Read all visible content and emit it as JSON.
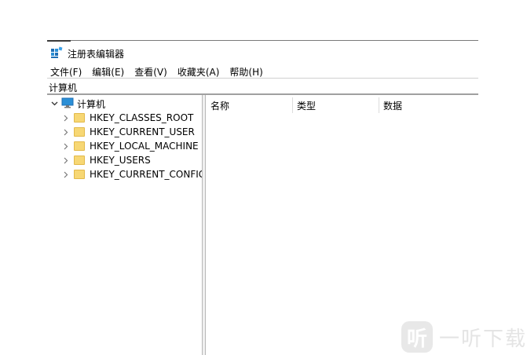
{
  "window": {
    "title": "注册表编辑器",
    "app_icon": "regedit-icon"
  },
  "menu": [
    {
      "label": "文件(F)"
    },
    {
      "label": "编辑(E)"
    },
    {
      "label": "查看(V)"
    },
    {
      "label": "收藏夹(A)"
    },
    {
      "label": "帮助(H)"
    }
  ],
  "address": {
    "value": "计算机"
  },
  "tree": {
    "root": {
      "label": "计算机",
      "icon": "computer-icon",
      "expanded": true
    },
    "children": [
      {
        "label": "HKEY_CLASSES_ROOT",
        "icon": "folder-icon"
      },
      {
        "label": "HKEY_CURRENT_USER",
        "icon": "folder-icon"
      },
      {
        "label": "HKEY_LOCAL_MACHINE",
        "icon": "folder-icon"
      },
      {
        "label": "HKEY_USERS",
        "icon": "folder-icon"
      },
      {
        "label": "HKEY_CURRENT_CONFIG",
        "icon": "folder-icon"
      }
    ]
  },
  "list": {
    "columns": [
      "名称",
      "类型",
      "数据"
    ]
  },
  "watermark": {
    "glyph": "听",
    "text": "一听下载"
  },
  "colors": {
    "folder": "#f7d774",
    "computer": "#2b8fd6"
  }
}
